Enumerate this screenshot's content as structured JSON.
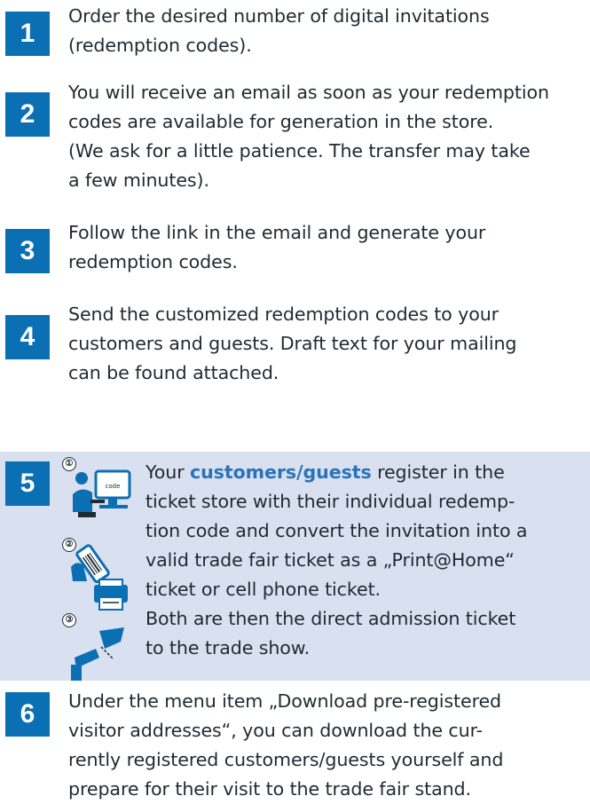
{
  "steps": [
    {
      "number": "1",
      "lines": [
        "Order the desired number of digital invitations",
        "(redemption codes)."
      ]
    },
    {
      "number": "2",
      "lines": [
        "You will receive an email as soon as your redemption",
        "codes are available for generation in the store.",
        "(We ask for a little patience. The transfer may take",
        "a few minutes)."
      ]
    },
    {
      "number": "3",
      "lines": [
        "Follow the link in the email and generate your",
        "redemption codes."
      ]
    },
    {
      "number": "4",
      "lines": [
        "Send the customized redemption codes to your",
        "customers and guests. Draft text for your mailing",
        "can be found attached."
      ]
    },
    {
      "number": "5",
      "line1_prefix": "Your ",
      "line1_bold": "customers/guests",
      "line1_suffix": " register in the",
      "lines": [
        "ticket store with their individual redemp-",
        "tion code and convert the invitation into a",
        "valid trade fair ticket as a „Print@Home“",
        "ticket or cell phone ticket.",
        "Both are then the direct admission ticket",
        "to the trade show."
      ],
      "icon_markers": [
        "①",
        "②",
        "③"
      ],
      "icon_code_text": "code"
    },
    {
      "number": "6",
      "lines": [
        "Under the menu item „Download pre-registered",
        "visitor addresses“, you can download the cur-",
        "rently registered customers/guests yourself and",
        "prepare for their visit to the trade fair stand."
      ]
    }
  ],
  "colors": {
    "number_box": "#0b6fb4",
    "highlight_bg": "#d9e0ef",
    "accent_text": "#2a73b8"
  }
}
